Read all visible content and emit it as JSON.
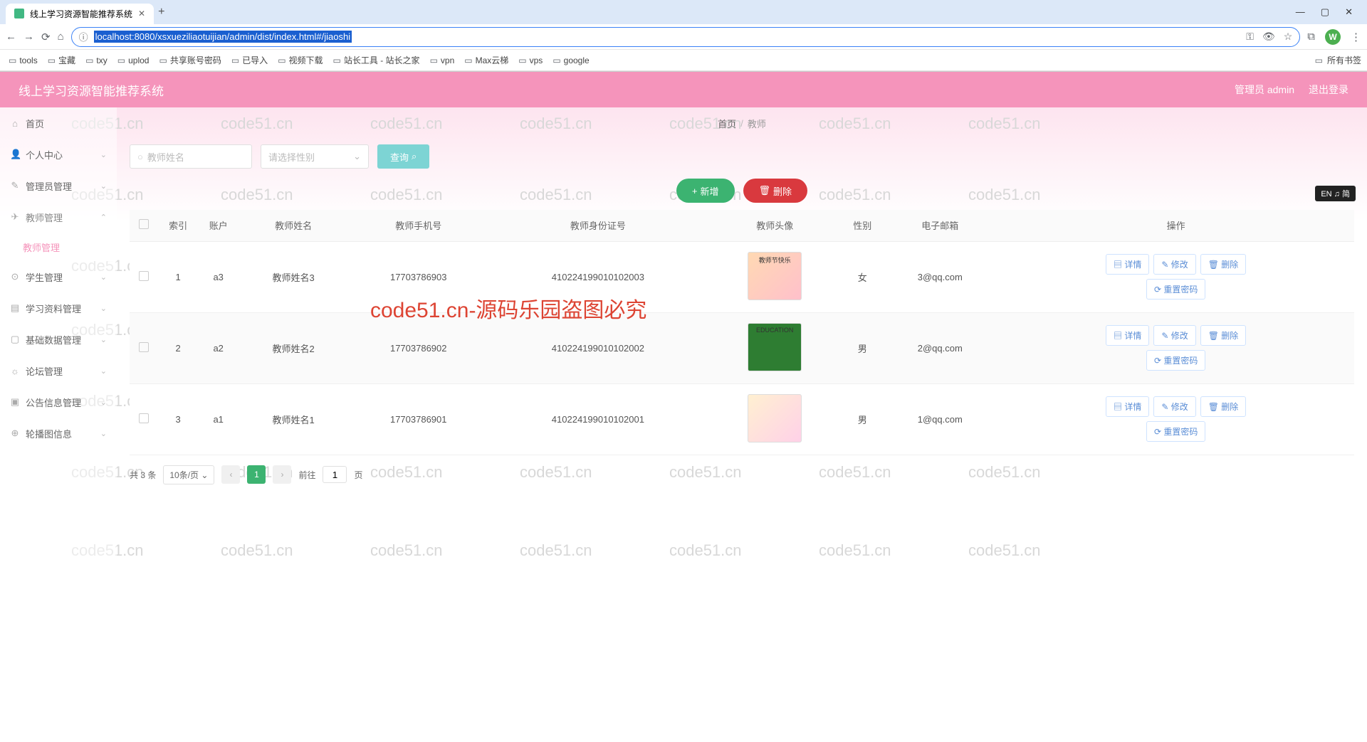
{
  "browser": {
    "tab_title": "线上学习资源智能推荐系统",
    "url": "localhost:8080/xsxueziliaotuijian/admin/dist/index.html#/jiaoshi",
    "avatar_letter": "W",
    "bookmarks": [
      "tools",
      "宝藏",
      "txy",
      "uplod",
      "共享账号密码",
      "已导入",
      "视频下载",
      "站长工具 - 站长之家",
      "vpn",
      "Max云梯",
      "vps",
      "google"
    ],
    "all_bookmarks": "所有书签"
  },
  "header": {
    "title": "线上学习资源智能推荐系统",
    "user": "管理员 admin",
    "logout": "退出登录"
  },
  "lang_badge": "EN ♫ 简",
  "sidebar": {
    "items": [
      {
        "icon": "⌂",
        "label": "首页"
      },
      {
        "icon": "👤",
        "label": "个人中心",
        "arrow": true
      },
      {
        "icon": "✎",
        "label": "管理员管理",
        "arrow": true
      },
      {
        "icon": "✈",
        "label": "教师管理",
        "arrow": true,
        "expanded": true
      },
      {
        "icon": "⊙",
        "label": "学生管理",
        "arrow": true
      },
      {
        "icon": "▤",
        "label": "学习资料管理",
        "arrow": true
      },
      {
        "icon": "▢",
        "label": "基础数据管理",
        "arrow": true
      },
      {
        "icon": "☼",
        "label": "论坛管理",
        "arrow": true
      },
      {
        "icon": "▣",
        "label": "公告信息管理",
        "arrow": true
      },
      {
        "icon": "⊕",
        "label": "轮播图信息",
        "arrow": true
      }
    ],
    "sub_active": "教师管理"
  },
  "breadcrumb": {
    "home": "首页",
    "current": "教师"
  },
  "filters": {
    "name_placeholder": "教师姓名",
    "gender_placeholder": "请选择性别",
    "query": "查询"
  },
  "action_buttons": {
    "add": "新增",
    "delete": "删除"
  },
  "table": {
    "columns": [
      "索引",
      "账户",
      "教师姓名",
      "教师手机号",
      "教师身份证号",
      "教师头像",
      "性别",
      "电子邮箱",
      "操作"
    ],
    "ops": {
      "detail": "详情",
      "edit": "修改",
      "delete": "删除",
      "reset": "重置密码"
    },
    "rows": [
      {
        "idx": "1",
        "account": "a3",
        "name": "教师姓名3",
        "phone": "17703786903",
        "idcard": "410224199010102003",
        "gender": "女",
        "email": "3@qq.com",
        "avcls": "av1",
        "avtxt": "教师节快乐"
      },
      {
        "idx": "2",
        "account": "a2",
        "name": "教师姓名2",
        "phone": "17703786902",
        "idcard": "410224199010102002",
        "gender": "男",
        "email": "2@qq.com",
        "avcls": "av2",
        "avtxt": "EDUCATION"
      },
      {
        "idx": "3",
        "account": "a1",
        "name": "教师姓名1",
        "phone": "17703786901",
        "idcard": "410224199010102001",
        "gender": "男",
        "email": "1@qq.com",
        "avcls": "av3",
        "avtxt": ""
      }
    ]
  },
  "pagination": {
    "total": "共 3 条",
    "page_size": "10条/页",
    "current": "1",
    "goto_prefix": "前往",
    "goto_value": "1",
    "goto_suffix": "页"
  },
  "watermark": "code51.cn",
  "watermark_red": "code51.cn-源码乐园盗图必究"
}
